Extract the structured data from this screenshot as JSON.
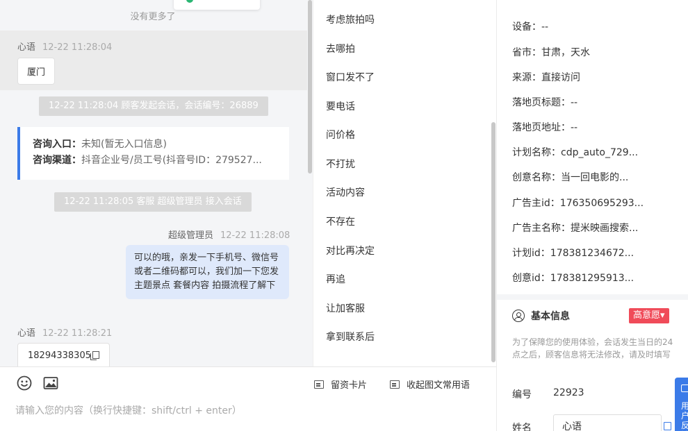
{
  "chat": {
    "no_more": "没有更多了",
    "messages": [
      {
        "sender": "心语",
        "time": "12-22 11:28:04",
        "text": "厦门"
      },
      {
        "system": "12-22 11:28:04 顾客发起会话，会话编号：26889"
      },
      {
        "entry_label": "咨询入口：",
        "entry_value": "未知(暂无入口信息)",
        "channel_label": "咨询渠道：",
        "channel_value": "抖音企业号/员工号(抖音号ID：279527..."
      },
      {
        "system": "12-22 11:28:05 客服 超级管理员 接入会话"
      },
      {
        "sender": "超级管理员",
        "time": "12-22 11:28:08",
        "text": "可以的哦，亲发一下手机号、微信号或者二维码都可以，我们加一下您发主题景点 套餐内容 拍摄流程了解下"
      },
      {
        "sender": "心语",
        "time": "12-22 11:28:21",
        "text": "18294338305"
      }
    ]
  },
  "phrases": [
    "考虑旅拍吗",
    "去哪拍",
    "窗口发不了",
    "要电话",
    "问价格",
    "不打扰",
    "活动内容",
    "不存在",
    "对比再决定",
    "再追",
    "让加客服",
    "拿到联系后"
  ],
  "composer": {
    "emoji_icon": "smile-icon",
    "image_icon": "image-icon",
    "card_button": "留资卡片",
    "collapse_button": "收起图文常用语",
    "placeholder": "请输入您的内容（换行快捷键：shift/ctrl + enter）"
  },
  "customer": {
    "source_rows": [
      {
        "label": "设备：",
        "value": "--"
      },
      {
        "label": "省市：",
        "value": "甘肃，天水"
      },
      {
        "label": "来源：",
        "value": "直接访问"
      },
      {
        "label": "落地页标题：",
        "value": "--"
      },
      {
        "label": "落地页地址：",
        "value": "--"
      },
      {
        "label": "计划名称：",
        "value": "cdp_auto_729..."
      },
      {
        "label": "创意名称：",
        "value": "当一回电影的..."
      },
      {
        "label": "广告主id：",
        "value": "176350695293..."
      },
      {
        "label": "广告主名称：",
        "value": "提米映画搜索..."
      },
      {
        "label": "计划id：",
        "value": "178381234672..."
      },
      {
        "label": "创意id：",
        "value": "178381295913..."
      }
    ],
    "basic_title": "基本信息",
    "intent_badge": "高意愿",
    "notice": "为了保障您的使用体验，会话发生当日的24点之后，顾客信息将无法修改，请及时填写",
    "id_label": "编号",
    "id_value": "22923",
    "name_label": "姓名",
    "name_value": "心语",
    "side_tab_text": "用户反馈"
  },
  "colors": {
    "accent": "#3b7be8",
    "badge": "#f04b59",
    "bubble_out": "#dfe9fb"
  }
}
